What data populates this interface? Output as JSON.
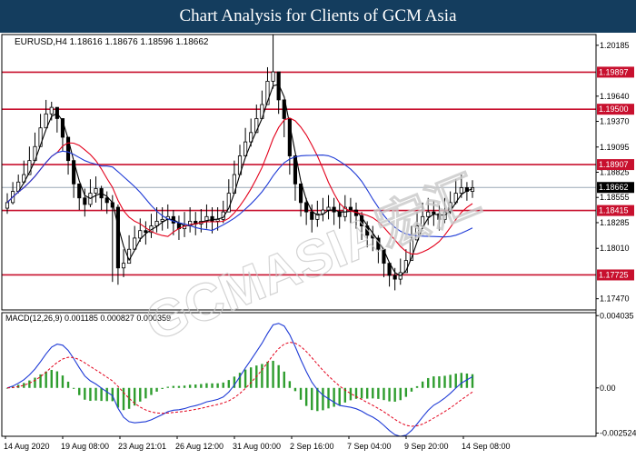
{
  "header": {
    "title": "Chart Analysis for Clients of GCM Asia"
  },
  "watermark": {
    "text": "GCMASIA宏汇"
  },
  "chart_data": [
    {
      "type": "candlestick",
      "name": "price-chart",
      "symbol_line": "EURUSD,H4  1.18616 1.18676 1.18596 1.18662",
      "ylim": [
        1.1735,
        1.203
      ],
      "y_ticks": [
        "1.20185",
        "1.19640",
        "1.19370",
        "1.19095",
        "1.18825",
        "1.18555",
        "1.18285",
        "1.18010",
        "1.17470"
      ],
      "horizontal_levels": [
        {
          "value": 1.19897,
          "label": "1.19897",
          "color": "#c8102e"
        },
        {
          "value": 1.195,
          "label": "1.19500",
          "color": "#c8102e"
        },
        {
          "value": 1.18907,
          "label": "1.18907",
          "color": "#c8102e"
        },
        {
          "value": 1.18415,
          "label": "1.18415",
          "color": "#c8102e"
        },
        {
          "value": 1.17725,
          "label": "1.17725",
          "color": "#c8102e"
        }
      ],
      "current_price": {
        "value": 1.18662,
        "label": "1.18662"
      },
      "candles_close": [
        1.185,
        1.1862,
        1.1872,
        1.188,
        1.1895,
        1.191,
        1.193,
        1.1945,
        1.1952,
        1.194,
        1.192,
        1.1895,
        1.187,
        1.1855,
        1.1848,
        1.186,
        1.1865,
        1.1855,
        1.185,
        1.1845,
        1.178,
        1.1785,
        1.18,
        1.1812,
        1.182,
        1.1818,
        1.1825,
        1.183,
        1.1832,
        1.1835,
        1.1828,
        1.1822,
        1.1825,
        1.183,
        1.1827,
        1.183,
        1.1835,
        1.183,
        1.1832,
        1.184,
        1.186,
        1.188,
        1.19,
        1.1915,
        1.1925,
        1.194,
        1.1955,
        1.198,
        1.199,
        1.196,
        1.194,
        1.19,
        1.187,
        1.185,
        1.184,
        1.1832,
        1.1838,
        1.1842,
        1.1845,
        1.184,
        1.1835,
        1.1845,
        1.1842,
        1.1836,
        1.1825,
        1.1815,
        1.1812,
        1.18,
        1.1785,
        1.1772,
        1.1768,
        1.1775,
        1.1788,
        1.181,
        1.1825,
        1.1835,
        1.184,
        1.1838,
        1.1832,
        1.184,
        1.185,
        1.186,
        1.1866,
        1.1862,
        1.1866
      ],
      "candles_high": [
        1.186,
        1.1872,
        1.188,
        1.1895,
        1.191,
        1.1925,
        1.1945,
        1.196,
        1.1958,
        1.195,
        1.1935,
        1.1915,
        1.189,
        1.187,
        1.1865,
        1.1875,
        1.1878,
        1.1868,
        1.1862,
        1.1858,
        1.1848,
        1.18,
        1.1815,
        1.1825,
        1.1833,
        1.183,
        1.1838,
        1.1845,
        1.1845,
        1.1848,
        1.1842,
        1.1836,
        1.184,
        1.1845,
        1.184,
        1.1843,
        1.1848,
        1.1845,
        1.1845,
        1.1852,
        1.1875,
        1.1895,
        1.1912,
        1.193,
        1.194,
        1.1955,
        1.197,
        1.1995,
        2.0,
        1.199,
        1.196,
        1.1935,
        1.19,
        1.187,
        1.1855,
        1.1848,
        1.1852,
        1.1855,
        1.1858,
        1.1855,
        1.185,
        1.1858,
        1.1855,
        1.185,
        1.184,
        1.183,
        1.1825,
        1.1815,
        1.18,
        1.1785,
        1.178,
        1.179,
        1.18,
        1.1825,
        1.184,
        1.185,
        1.1855,
        1.1852,
        1.1847,
        1.1855,
        1.1862,
        1.1875,
        1.188,
        1.1872,
        1.1874
      ],
      "candles_low": [
        1.1838,
        1.1848,
        1.186,
        1.187,
        1.1882,
        1.1898,
        1.1918,
        1.1932,
        1.1938,
        1.1925,
        1.1905,
        1.188,
        1.1855,
        1.1842,
        1.1835,
        1.1845,
        1.185,
        1.1842,
        1.1838,
        1.1765,
        1.1762,
        1.177,
        1.1788,
        1.18,
        1.1808,
        1.1805,
        1.1812,
        1.1818,
        1.182,
        1.1822,
        1.1815,
        1.181,
        1.1813,
        1.1818,
        1.1815,
        1.1818,
        1.1822,
        1.1817,
        1.182,
        1.1828,
        1.1845,
        1.1865,
        1.1885,
        1.19,
        1.191,
        1.1925,
        1.194,
        1.1965,
        1.1972,
        1.1945,
        1.192,
        1.188,
        1.1852,
        1.1835,
        1.1826,
        1.1818,
        1.1824,
        1.183,
        1.1832,
        1.1826,
        1.1822,
        1.183,
        1.1828,
        1.1822,
        1.181,
        1.1802,
        1.1798,
        1.1785,
        1.177,
        1.176,
        1.1756,
        1.1762,
        1.1775,
        1.1795,
        1.1812,
        1.1822,
        1.1826,
        1.1825,
        1.182,
        1.1828,
        1.1838,
        1.1848,
        1.1855,
        1.1852,
        1.1855
      ],
      "moving_averages": [
        {
          "color": "#000000",
          "period": "fast"
        },
        {
          "color": "#e3001b",
          "period": "medium"
        },
        {
          "color": "#1f3bd6",
          "period": "slow"
        }
      ]
    },
    {
      "type": "macd",
      "name": "macd-panel",
      "label": "MACD(12,26,9) 0.001185 0.000827 0.000359",
      "ylim": [
        -0.0027,
        0.0042
      ],
      "y_ticks": [
        "0.004035",
        "0.00",
        "-0.002524"
      ],
      "histogram_color": "#2e9d2e",
      "macd_line_color": "#1f3bd6",
      "signal_line_color": "#e3001b"
    }
  ],
  "x_axis": {
    "labels": [
      "14 Aug 2020",
      "19 Aug 08:00",
      "23 Aug 21:01",
      "26 Aug 12:00",
      "31 Aug 00:00",
      "2 Sep 16:00",
      "7 Sep 04:00",
      "9 Sep 20:00",
      "14 Sep 08:00"
    ]
  }
}
